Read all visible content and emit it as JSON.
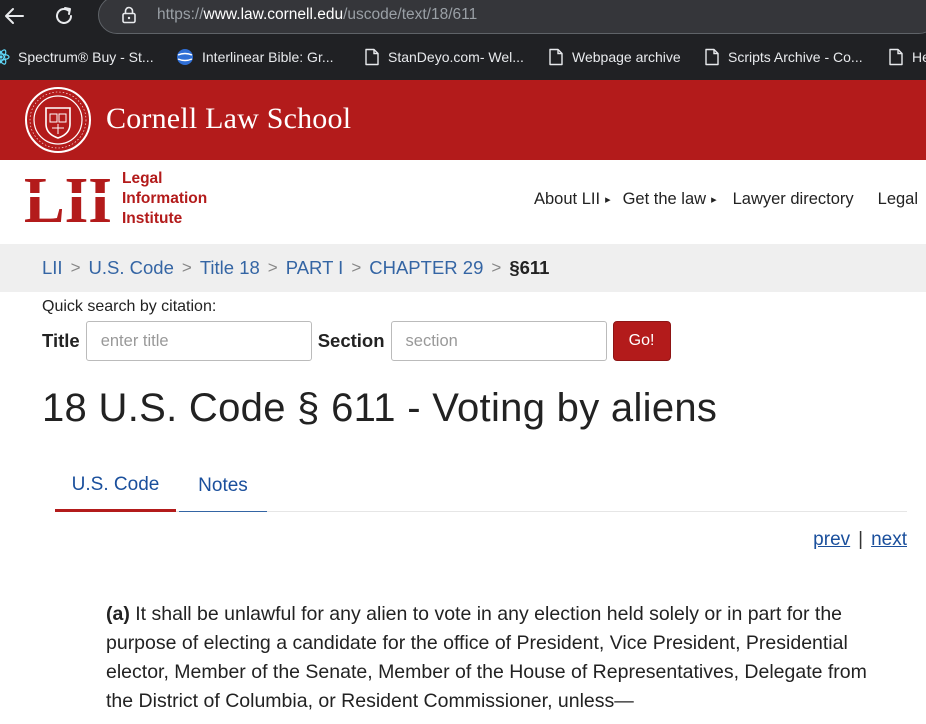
{
  "browser": {
    "url_prefix": "https://",
    "url_host": "www.law.cornell.edu",
    "url_path": "/uscode/text/18/611",
    "bookmarks": [
      {
        "label": "Spectrum® Buy - St...",
        "icon": "react-icon"
      },
      {
        "label": "Interlinear Bible: Gr...",
        "icon": "globe-icon"
      },
      {
        "label": "StanDeyo.com- Wel...",
        "icon": "page-icon"
      },
      {
        "label": "Webpage archive",
        "icon": "page-icon"
      },
      {
        "label": "Scripts Archive - Co...",
        "icon": "page-icon"
      },
      {
        "label": "He",
        "icon": "page-icon"
      }
    ]
  },
  "banner": {
    "title": "Cornell Law School"
  },
  "lii": {
    "logo_text": "LII",
    "name_lines": [
      "Legal",
      "Information",
      "Institute"
    ],
    "nav": [
      {
        "label": "About LII",
        "caret": "▸"
      },
      {
        "label": "Get the law",
        "caret": "▸"
      },
      {
        "label": "Lawyer directory",
        "caret": ""
      },
      {
        "label": "Legal",
        "caret": ""
      }
    ]
  },
  "breadcrumb": {
    "items": [
      "LII",
      "U.S. Code",
      "Title 18",
      "PART I",
      "CHAPTER 29"
    ],
    "separator": ">",
    "current": "§611"
  },
  "quick_search": {
    "label": "Quick search by citation:",
    "title_label": "Title",
    "title_placeholder": "enter title",
    "section_label": "Section",
    "section_placeholder": "section",
    "go_label": "Go!"
  },
  "page": {
    "title": "18 U.S. Code § 611 - Voting by aliens",
    "tabs": [
      "U.S. Code",
      "Notes"
    ],
    "prev_label": "prev",
    "next_label": "next",
    "divider": "|",
    "paragraph_marker": "(a)",
    "paragraph_text": "It shall be unlawful for any alien to vote in any election held solely or in part for the purpose of electing a candidate for the office of President, Vice President, Presidential elector, Member of the Senate, Member of the House of Representatives, Delegate from the District of Columbia, or Resident Commissioner, unless—"
  },
  "colors": {
    "cornell_red": "#b31b1b",
    "link_blue": "#1a4f9c",
    "breadcrumb_bg": "#efefef",
    "chrome_bg": "#202124"
  }
}
